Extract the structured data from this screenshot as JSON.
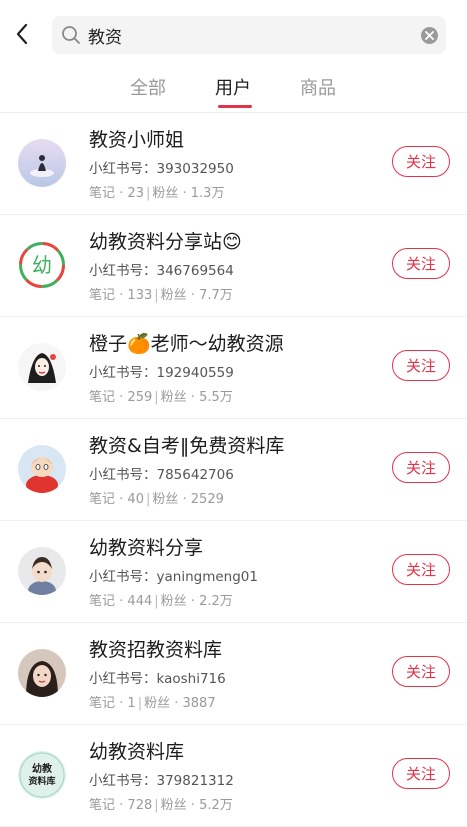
{
  "search": {
    "query": "教资"
  },
  "tabs": [
    {
      "label": "全部",
      "active": false
    },
    {
      "label": "用户",
      "active": true
    },
    {
      "label": "商品",
      "active": false
    }
  ],
  "colors": {
    "accent": "#e0344a"
  },
  "users": [
    {
      "name": "教资小师姐",
      "id_label": "小红书号：",
      "id": "393032950",
      "notes_label": "笔记",
      "notes": "23",
      "fans_label": "粉丝",
      "fans": "1.3万",
      "follow": "关注"
    },
    {
      "name": "幼教资料分享站😊",
      "id_label": "小红书号：",
      "id": "346769564",
      "notes_label": "笔记",
      "notes": "133",
      "fans_label": "粉丝",
      "fans": "7.7万",
      "follow": "关注"
    },
    {
      "name": "橙子🍊老师～幼教资源",
      "id_label": "小红书号：",
      "id": "192940559",
      "notes_label": "笔记",
      "notes": "259",
      "fans_label": "粉丝",
      "fans": "5.5万",
      "follow": "关注"
    },
    {
      "name": "教资&自考‖免费资料库",
      "id_label": "小红书号：",
      "id": "785642706",
      "notes_label": "笔记",
      "notes": "40",
      "fans_label": "粉丝",
      "fans": "2529",
      "follow": "关注"
    },
    {
      "name": "幼教资料分享",
      "id_label": "小红书号：",
      "id": "yaningmeng01",
      "notes_label": "笔记",
      "notes": "444",
      "fans_label": "粉丝",
      "fans": "2.2万",
      "follow": "关注"
    },
    {
      "name": "教资招教资料库",
      "id_label": "小红书号：",
      "id": "kaoshi716",
      "notes_label": "笔记",
      "notes": "1",
      "fans_label": "粉丝",
      "fans": "3887",
      "follow": "关注"
    },
    {
      "name": "幼教资料库",
      "id_label": "小红书号：",
      "id": "379821312",
      "notes_label": "笔记",
      "notes": "728",
      "fans_label": "粉丝",
      "fans": "5.2万",
      "follow": "关注"
    }
  ],
  "avatar_badges": {
    "avatar2_char": "幼",
    "avatar7_line1": "幼教",
    "avatar7_line2": "资料库"
  }
}
